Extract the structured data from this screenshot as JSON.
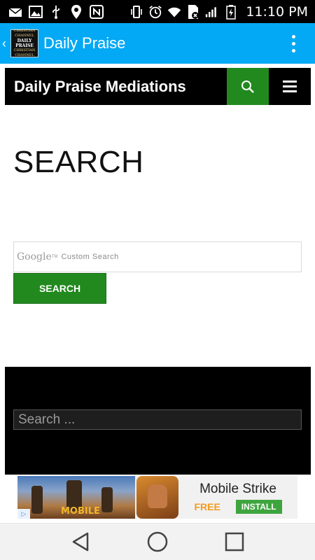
{
  "status_bar": {
    "time": "11:10 PM",
    "icons": [
      "email-icon",
      "image-icon",
      "usb-icon",
      "location-icon",
      "nfc-icon",
      "vibrate-icon",
      "alarm-icon",
      "wifi-icon",
      "sim-icon",
      "signal-icon",
      "battery-charging-icon"
    ]
  },
  "app_bar": {
    "title": "Daily Praise",
    "logo_line1": "CHRISTIAN CHANNEL",
    "logo_line2": "DAILY PRAISE",
    "logo_line3": "CHRISTIAN CHANNEL",
    "accent_color": "#03A9F4"
  },
  "site_header": {
    "title": "Daily Praise Mediations",
    "search_button_color": "#22891e"
  },
  "page": {
    "heading": "SEARCH"
  },
  "google_search": {
    "google_label": "Google",
    "tm": "TM",
    "placeholder": "Custom Search",
    "button_label": "SEARCH"
  },
  "footer": {
    "search_placeholder": "Search ..."
  },
  "ad": {
    "scene_label": "MOBILE",
    "badge": "▷",
    "app_name": "Mobile Strike",
    "price": "FREE",
    "install_label": "INSTALL"
  },
  "nav_bar": {
    "buttons": [
      "back-icon",
      "home-icon",
      "recents-icon"
    ]
  }
}
